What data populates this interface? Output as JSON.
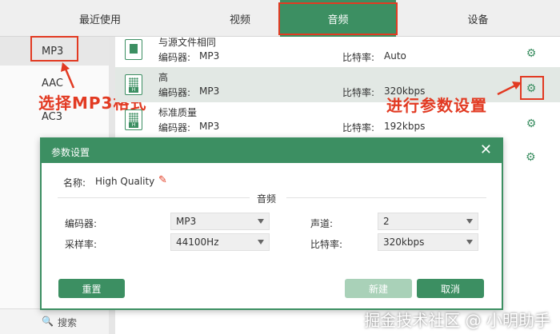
{
  "tabs": [
    {
      "label": "最近使用",
      "active": false
    },
    {
      "label": "视频",
      "active": false
    },
    {
      "label": "音频",
      "active": true
    },
    {
      "label": "设备",
      "active": false
    }
  ],
  "formats": [
    "MP3",
    "AAC",
    "AC3"
  ],
  "selected_format": "MP3",
  "presets": [
    {
      "name": "与源文件相同",
      "codec_label": "编码器:",
      "codec": "MP3",
      "bitrate_label": "比特率:",
      "bitrate": "Auto",
      "icon": "file-copy-icon"
    },
    {
      "name": "高",
      "codec_label": "编码器:",
      "codec": "MP3",
      "bitrate_label": "比特率:",
      "bitrate": "320kbps",
      "icon": "audio-hq-icon"
    },
    {
      "name": "标准质量",
      "codec_label": "编码器:",
      "codec": "MP3",
      "bitrate_label": "比特率:",
      "bitrate": "192kbps",
      "icon": "audio-sq-icon"
    }
  ],
  "annotations": {
    "select_mp3": "选择MP3格式",
    "param_settings": "进行参数设置"
  },
  "search": {
    "label": "搜索"
  },
  "dialog": {
    "title": "参数设置",
    "name_label": "名称:",
    "name_value": "High Quality",
    "section_title": "音频",
    "encoder_label": "编码器:",
    "encoder_value": "MP3",
    "samplerate_label": "采样率:",
    "samplerate_value": "44100Hz",
    "channel_label": "声道:",
    "channel_value": "2",
    "bitrate_label": "比特率:",
    "bitrate_value": "320kbps",
    "reset_label": "重置",
    "new_label": "新建",
    "cancel_label": "取消"
  },
  "watermark": "掘金技术社区 @ 小明助手",
  "colors": {
    "accent": "#3c8f62",
    "annotation": "#e23a22",
    "selected_row": "#e2e8e4"
  }
}
